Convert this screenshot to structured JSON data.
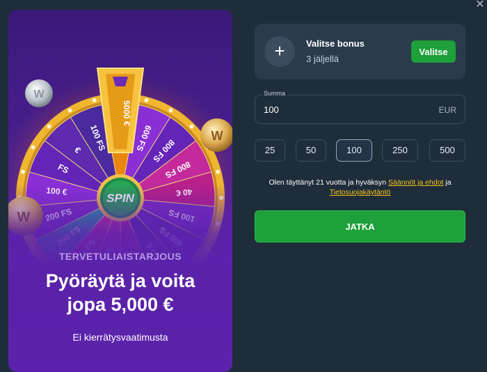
{
  "promo": {
    "eyebrow": "TERVETULIAISTARJOUS",
    "title_line1": "Pyöräytä ja voita",
    "title_line2": "jopa 5,000 €",
    "subtitle": "Ei kierrätysvaatimusta",
    "spin_label": "SPIN",
    "wheel_segments": [
      "5000 €",
      "600 FS",
      "800 FS",
      "800 FS",
      "40 €",
      "100 FS",
      "400 FS",
      "200 €",
      "100 €",
      "200 FS",
      "800 FS",
      "200 FS",
      "200 FS",
      "100 €",
      "FS",
      "€",
      "100 FS"
    ]
  },
  "bonus": {
    "title": "Valitse bonus",
    "remaining": "3 jäljellä",
    "button_label": "Valitse",
    "plus_symbol": "+"
  },
  "amount": {
    "label": "Summa",
    "value": "100",
    "currency": "EUR"
  },
  "presets": [
    "25",
    "50",
    "100",
    "250",
    "500"
  ],
  "terms": {
    "prefix": "Olen täyttänyt 21 vuotta ja hyväksyn ",
    "link1": "Säännöt ja ehdot",
    "middle": " ja",
    "link2": "Tietosuojakäytäntö"
  },
  "continue_label": "JATKA",
  "close_symbol": "✕",
  "colors": {
    "background": "#1f2d3b",
    "card": "#2a3b4c",
    "accent_green": "#1ea03a",
    "link_yellow": "#f5c518",
    "promo_purple": "#5b22ab"
  }
}
